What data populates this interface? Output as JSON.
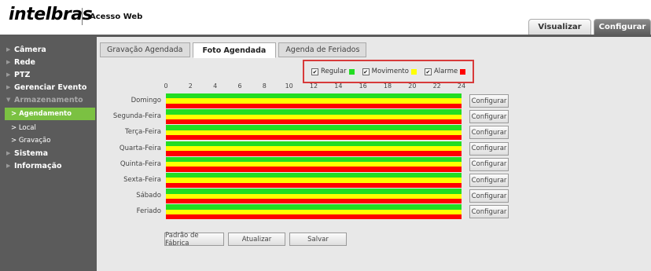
{
  "header": {
    "logo": "intelbras",
    "app_name": "Acesso Web",
    "tabs": [
      {
        "label": "Visualizar"
      },
      {
        "label": "Configurar"
      }
    ]
  },
  "sidebar": {
    "items": [
      {
        "label": "Câmera"
      },
      {
        "label": "Rede"
      },
      {
        "label": "PTZ"
      },
      {
        "label": "Gerenciar Evento"
      },
      {
        "label": "Armazenamento"
      },
      {
        "label": "> Agendamento"
      },
      {
        "label": "> Local"
      },
      {
        "label": "> Gravação"
      },
      {
        "label": "Sistema"
      },
      {
        "label": "Informação"
      }
    ]
  },
  "subtabs": [
    {
      "label": "Gravação Agendada"
    },
    {
      "label": "Foto Agendada"
    },
    {
      "label": "Agenda de Feriados"
    }
  ],
  "legend": {
    "items": [
      {
        "label": "Regular",
        "checked": true,
        "color": "#22dd22"
      },
      {
        "label": "Movimento",
        "checked": true,
        "color": "#ffff00"
      },
      {
        "label": "Alarme",
        "checked": true,
        "color": "#ff0000"
      }
    ]
  },
  "hours": [
    "0",
    "2",
    "4",
    "6",
    "8",
    "10",
    "12",
    "14",
    "16",
    "18",
    "20",
    "22",
    "24"
  ],
  "schedule": {
    "rows": [
      {
        "day": "Domingo",
        "button": "Configurar"
      },
      {
        "day": "Segunda-Feira",
        "button": "Configurar"
      },
      {
        "day": "Terça-Feira",
        "button": "Configurar"
      },
      {
        "day": "Quarta-Feira",
        "button": "Configurar"
      },
      {
        "day": "Quinta-Feira",
        "button": "Configurar"
      },
      {
        "day": "Sexta-Feira",
        "button": "Configurar"
      },
      {
        "day": "Sábado",
        "button": "Configurar"
      },
      {
        "day": "Feriado",
        "button": "Configurar"
      }
    ],
    "band_colors": [
      "#22dd22",
      "#ffff00",
      "#ff0000"
    ]
  },
  "actions": {
    "default_label": "Padrão de Fábrica",
    "refresh_label": "Atualizar",
    "save_label": "Salvar"
  }
}
